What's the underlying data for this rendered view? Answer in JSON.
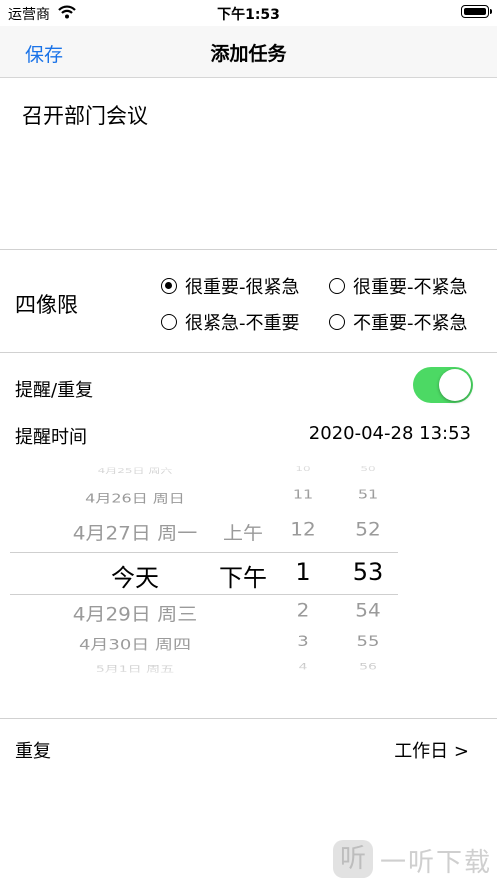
{
  "status_bar": {
    "carrier": "运营商",
    "time": "下午1:53"
  },
  "nav": {
    "save_label": "保存",
    "title": "添加任务"
  },
  "task": {
    "text": "召开部门会议"
  },
  "quadrant": {
    "label": "四像限",
    "options": [
      {
        "label": "很重要-很紧急",
        "selected": true
      },
      {
        "label": "很重要-不紧急",
        "selected": false
      },
      {
        "label": "很紧急-不重要",
        "selected": false
      },
      {
        "label": "不重要-不紧急",
        "selected": false
      }
    ]
  },
  "reminder": {
    "label": "提醒/重复",
    "enabled": true,
    "time_label": "提醒时间",
    "time_value": "2020-04-28 13:53"
  },
  "picker": {
    "rows": [
      {
        "date": "4月25日 周六",
        "ampm": "",
        "hour": "10",
        "minute": "50"
      },
      {
        "date": "4月26日 周日",
        "ampm": "",
        "hour": "11",
        "minute": "51"
      },
      {
        "date": "4月27日 周一",
        "ampm": "上午",
        "hour": "12",
        "minute": "52"
      },
      {
        "date": "今天",
        "ampm": "下午",
        "hour": "1",
        "minute": "53"
      },
      {
        "date": "4月29日 周三",
        "ampm": "",
        "hour": "2",
        "minute": "54"
      },
      {
        "date": "4月30日 周四",
        "ampm": "",
        "hour": "3",
        "minute": "55"
      },
      {
        "date": "5月1日 周五",
        "ampm": "",
        "hour": "4",
        "minute": "56"
      }
    ]
  },
  "repeat": {
    "label": "重复",
    "value": "工作日 >"
  },
  "watermark": {
    "logo": "听",
    "text": "一听下载"
  }
}
